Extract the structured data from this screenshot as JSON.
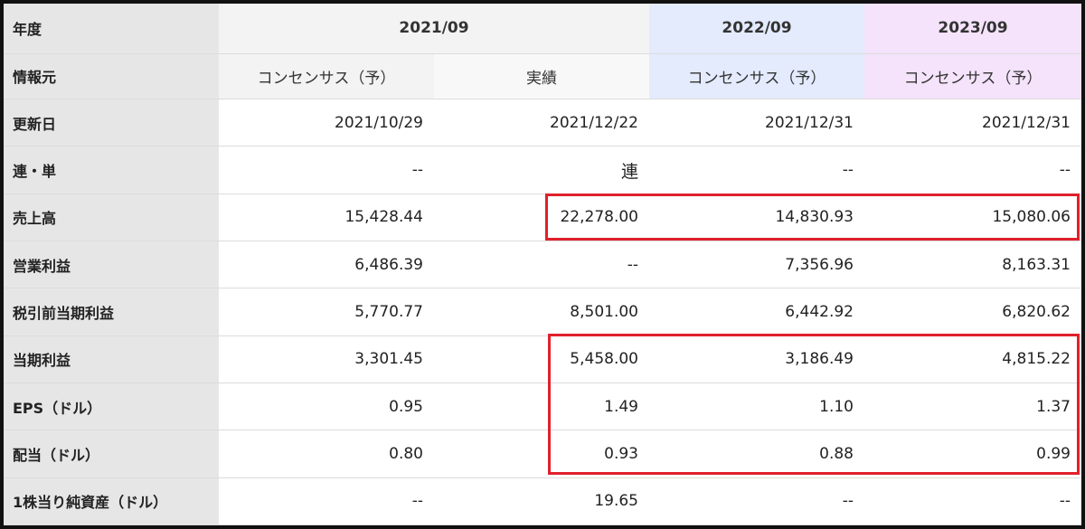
{
  "header": {
    "year_label": "年度",
    "years": [
      "2021/09",
      "2022/09",
      "2023/09"
    ],
    "source_label": "情報元",
    "sources": [
      "コンセンサス（予）",
      "実績",
      "コンセンサス（予）",
      "コンセンサス（予）"
    ]
  },
  "rows": [
    {
      "label": "更新日",
      "values": [
        "2021/10/29",
        "2021/12/22",
        "2021/12/31",
        "2021/12/31"
      ]
    },
    {
      "label": "連・単",
      "values": [
        "--",
        "連",
        "--",
        "--"
      ]
    },
    {
      "label": "売上高",
      "values": [
        "15,428.44",
        "22,278.00",
        "14,830.93",
        "15,080.06"
      ]
    },
    {
      "label": "営業利益",
      "values": [
        "6,486.39",
        "--",
        "7,356.96",
        "8,163.31"
      ]
    },
    {
      "label": "税引前当期利益",
      "values": [
        "5,770.77",
        "8,501.00",
        "6,442.92",
        "6,820.62"
      ]
    },
    {
      "label": "当期利益",
      "values": [
        "3,301.45",
        "5,458.00",
        "3,186.49",
        "4,815.22"
      ]
    },
    {
      "label": "EPS（ドル）",
      "values": [
        "0.95",
        "1.49",
        "1.10",
        "1.37"
      ]
    },
    {
      "label": "配当（ドル）",
      "values": [
        "0.80",
        "0.93",
        "0.88",
        "0.99"
      ]
    },
    {
      "label": "1株当り純資産（ドル）",
      "values": [
        "--",
        "19.65",
        "--",
        "--"
      ]
    }
  ],
  "colors": {
    "highlight": "#e0202c",
    "label_bg": "#e6e6e6",
    "col_2022_bg": "#e3ebfd",
    "col_2023_bg": "#f4e3fb"
  }
}
